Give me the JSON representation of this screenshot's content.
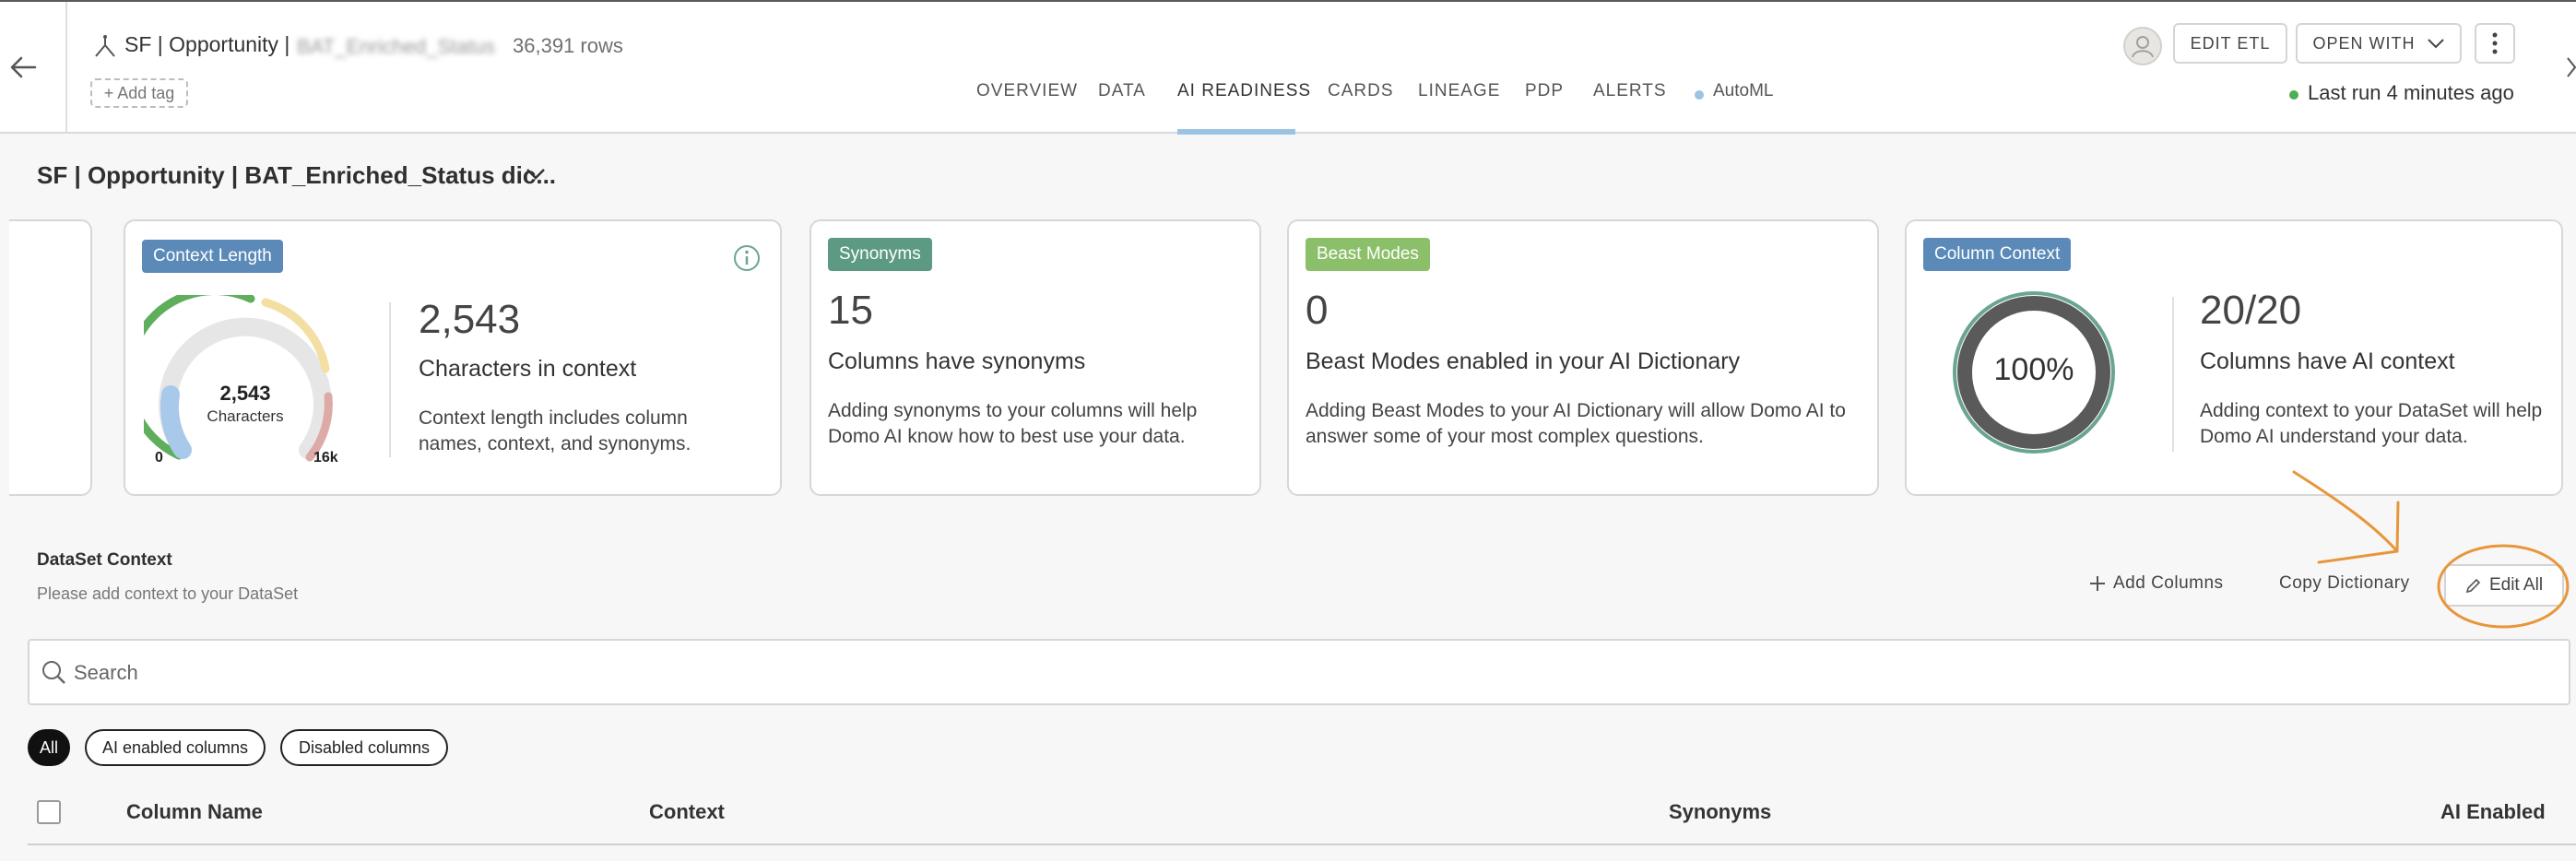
{
  "header": {
    "dataset_title": "SF | Opportunity | ",
    "dataset_title_redacted": "BAT_Enriched_Status",
    "row_count": "36,391 rows",
    "add_tag": "+ Add tag",
    "edit_etl": "EDIT ETL",
    "open_with": "OPEN WITH",
    "last_run": "Last run 4 minutes ago"
  },
  "tabs": [
    "OVERVIEW",
    "DATA",
    "AI READINESS",
    "CARDS",
    "LINEAGE",
    "PDP",
    "ALERTS",
    "AutoML"
  ],
  "active_tab": "AI READINESS",
  "dictionary": {
    "title": "SF | Opportunity | BAT_Enriched_Status dic..."
  },
  "cards": {
    "context_length": {
      "badge": "Context Length",
      "gauge_value": "2,543",
      "gauge_unit": "Characters",
      "gauge_min": "0",
      "gauge_max": "16k",
      "big_number": "2,543",
      "subtitle": "Characters in context",
      "description": "Context length includes column names, context, and synonyms."
    },
    "synonyms": {
      "badge": "Synonyms",
      "big_number": "15",
      "subtitle": "Columns have synonyms",
      "description": "Adding synonyms to your columns will help Domo AI know how to best use your data."
    },
    "beast_modes": {
      "badge": "Beast Modes",
      "big_number": "0",
      "subtitle": "Beast Modes enabled in your AI Dictionary",
      "description": "Adding Beast Modes to your AI Dictionary will allow Domo AI to answer some of your most complex questions."
    },
    "column_context": {
      "badge": "Column Context",
      "ring_value": "100%",
      "big_number": "20/20",
      "subtitle": "Columns have AI context",
      "description": "Adding context to your DataSet will help Domo AI understand your data."
    }
  },
  "dataset_context": {
    "label": "DataSet Context",
    "hint": "Please add context to your DataSet",
    "add_columns": "Add Columns",
    "copy_dictionary": "Copy Dictionary",
    "edit_all": "Edit All"
  },
  "search": {
    "placeholder": "Search"
  },
  "filters": [
    "All",
    "AI enabled columns",
    "Disabled columns"
  ],
  "table": {
    "headers": [
      "Column Name",
      "Context",
      "Synonyms",
      "AI Enabled"
    ]
  },
  "colors": {
    "context_badge": "#5b8ab8",
    "synonyms_badge": "#5d9a84",
    "beast_badge": "#8cbf6a",
    "column_badge": "#5b8ab8",
    "tab_accent": "#9cc3e2",
    "annotation": "#e8963a"
  }
}
